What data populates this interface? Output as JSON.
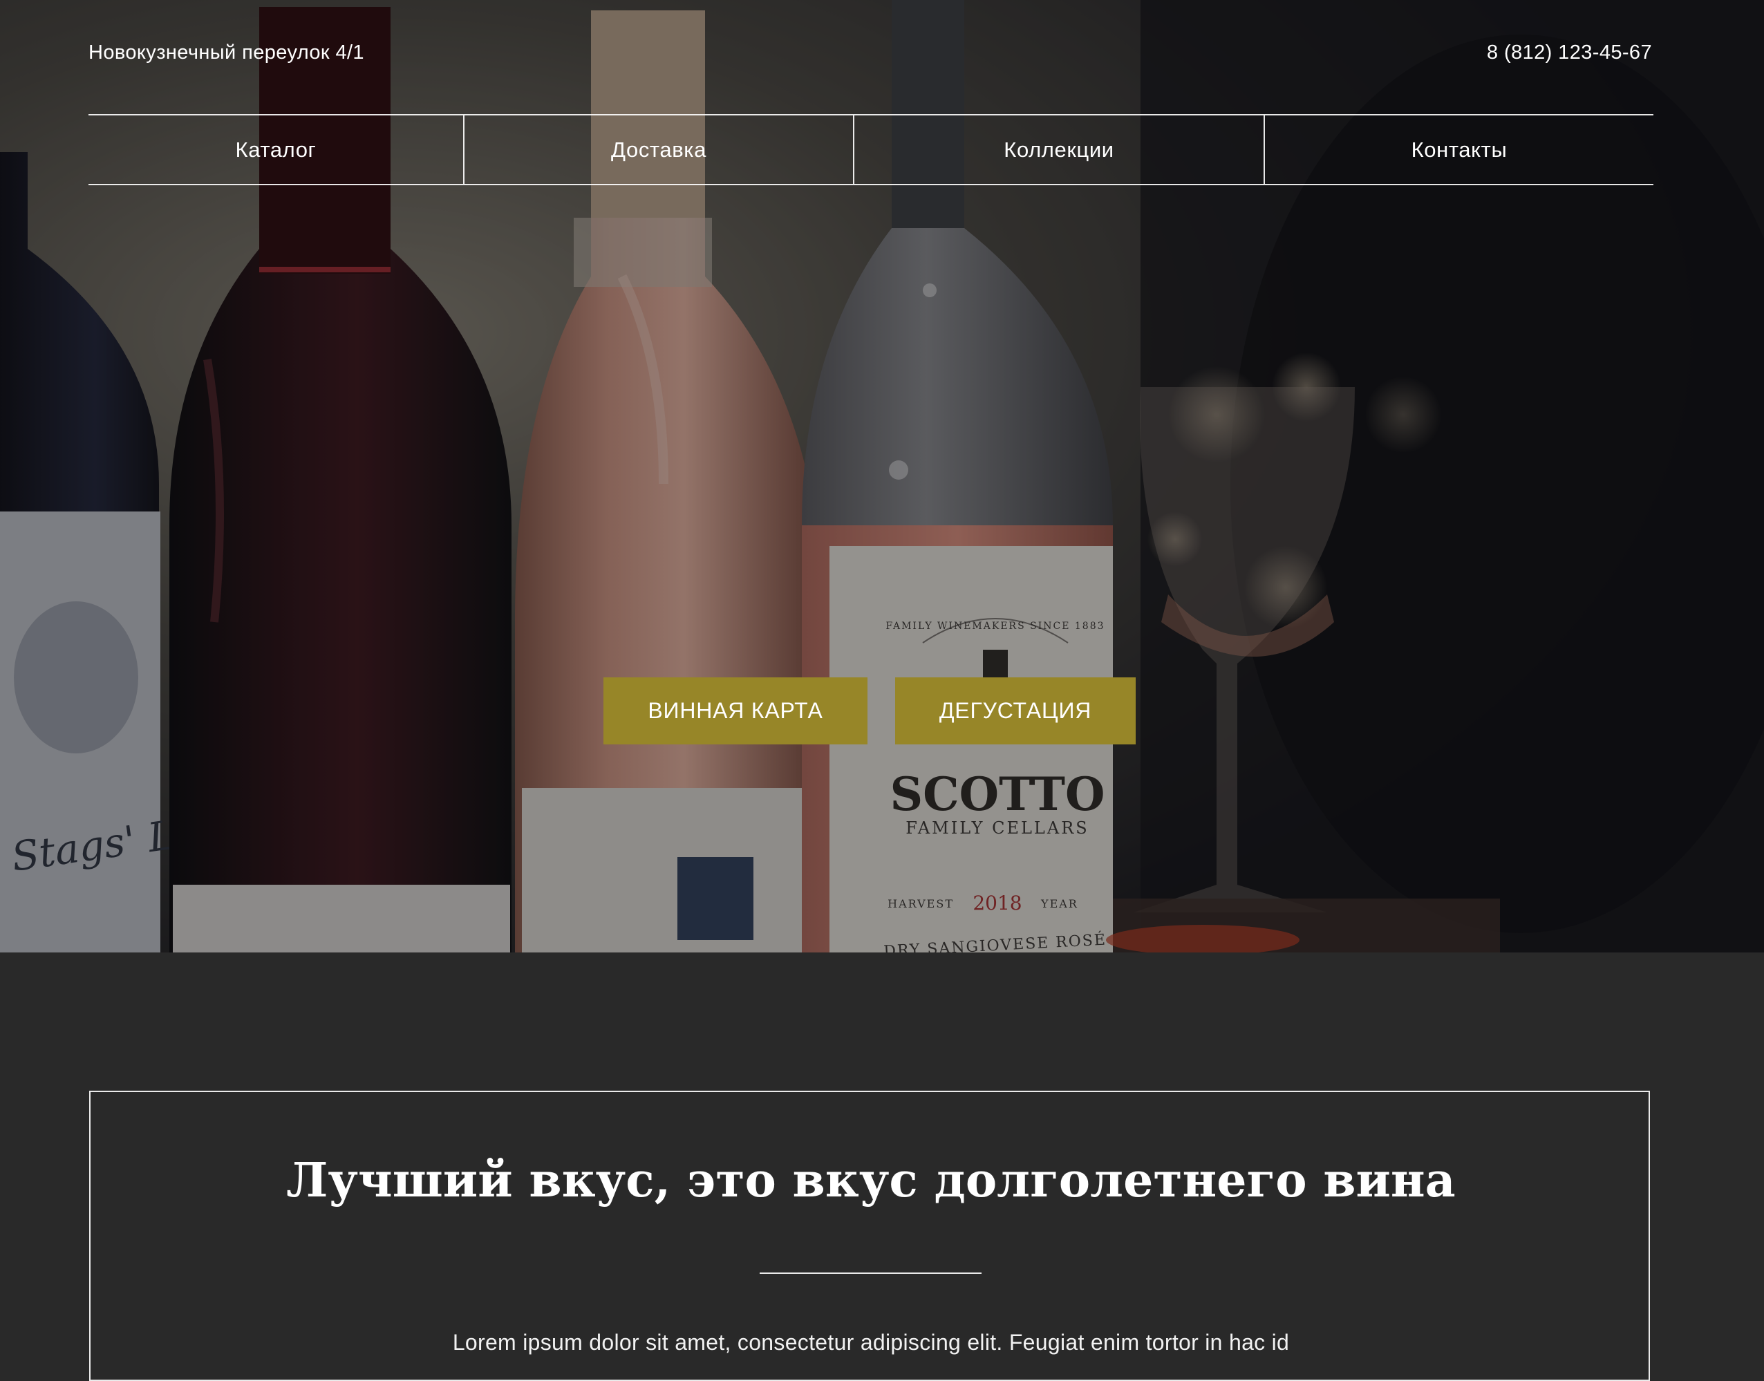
{
  "header": {
    "address": "Новокузнечный переулок 4/1",
    "phone": "8 (812) 123-45-67"
  },
  "nav": {
    "items": [
      {
        "label": "Каталог"
      },
      {
        "label": "Доставка"
      },
      {
        "label": "Коллекции"
      },
      {
        "label": "Контакты"
      }
    ]
  },
  "hero": {
    "buttons": {
      "wine_list": "ВИННАЯ КАРТА",
      "tasting": "ДЕГУСТАЦИЯ"
    },
    "bottle_labels": {
      "left_label": "Stags' Leap",
      "scotto_brand": "SCOTTO",
      "scotto_sub": "FAMILY CELLARS",
      "scotto_arc": "FAMILY WINEMAKERS SINCE 1883",
      "scotto_harvest": "HARVEST",
      "scotto_year": "2018",
      "scotto_year_suffix": "YEAR",
      "scotto_variety": "DRY SANGIOVESE ROSÉ"
    }
  },
  "about": {
    "headline": "Лучший вкус, это вкус долголетнего вина",
    "text": "Lorem ipsum dolor sit amet, consectetur adipiscing elit. Feugiat enim tortor in hac id"
  },
  "colors": {
    "background": "#292929",
    "accent_button": "#978628",
    "text": "#ffffff"
  }
}
